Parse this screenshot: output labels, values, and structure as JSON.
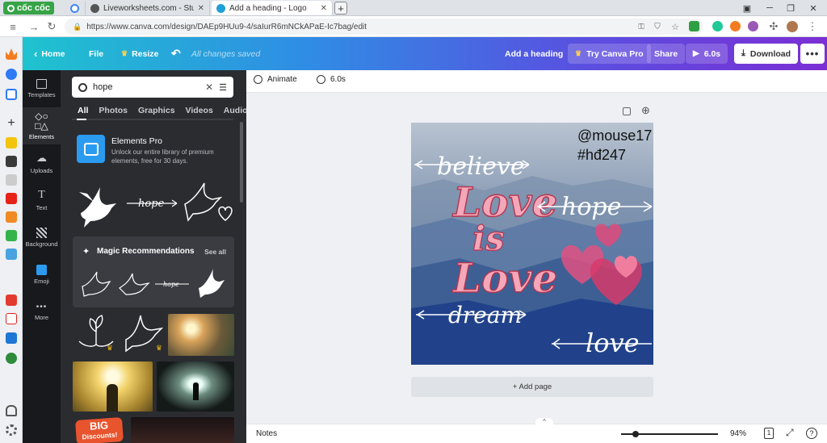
{
  "browser": {
    "logo_text": "cốc cốc",
    "tabs": [
      {
        "title": "",
        "favicon_color": "#4285f4"
      },
      {
        "title": "Liveworksheets.com - Studer",
        "favicon_color": "#555"
      },
      {
        "title": "Add a heading - Logo",
        "favicon_color": "#1fa0d9"
      }
    ],
    "url": "https://www.canva.com/design/DAEp9HUu9-4/saIurR6mNCkAPaE-Ic7bag/edit"
  },
  "header": {
    "home": "Home",
    "file": "File",
    "resize": "Resize",
    "saved_status": "All changes saved",
    "doc_title": "Add a heading",
    "try_pro": "Try Canva Pro",
    "share": "Share",
    "play_duration": "6.0s",
    "download": "Download"
  },
  "rail": {
    "items": [
      {
        "label": "Templates",
        "icon": "templates-icon"
      },
      {
        "label": "Elements",
        "icon": "elements-icon"
      },
      {
        "label": "Uploads",
        "icon": "uploads-icon"
      },
      {
        "label": "Text",
        "icon": "text-icon"
      },
      {
        "label": "Background",
        "icon": "background-icon"
      },
      {
        "label": "Emoji",
        "icon": "emoji-icon"
      },
      {
        "label": "More",
        "icon": "more-icon"
      }
    ]
  },
  "panel": {
    "search_value": "hope",
    "tabs": [
      "All",
      "Photos",
      "Graphics",
      "Videos",
      "Audio"
    ],
    "elements_pro_title": "Elements Pro",
    "elements_pro_desc": "Unlock our entire library of premium elements, free for 30 days.",
    "magic_title": "Magic Recommendations",
    "see_all": "See all",
    "big_discount_line1": "BIG",
    "big_discount_line2": "Discounts!"
  },
  "toolbar": {
    "animate": "Animate",
    "duration": "6.0s"
  },
  "canvas": {
    "watermark_line1": "@mouse17",
    "watermark_line2": "#hđ247",
    "word_believe": "believe",
    "word_love1": "Love",
    "word_is": "is",
    "word_love2": "Love",
    "word_hope": "hope",
    "word_dream": "dream",
    "word_love3": "love",
    "add_page": "+ Add page"
  },
  "footer": {
    "notes": "Notes",
    "zoom": "94%",
    "page_count": "1"
  },
  "colors": {
    "canva_gradient_start": "#1fc3cf",
    "canva_gradient_end": "#7b2fd4",
    "panel_bg": "#2a2c30",
    "rail_bg": "#18191c",
    "love_pink": "#f4a7b9"
  }
}
